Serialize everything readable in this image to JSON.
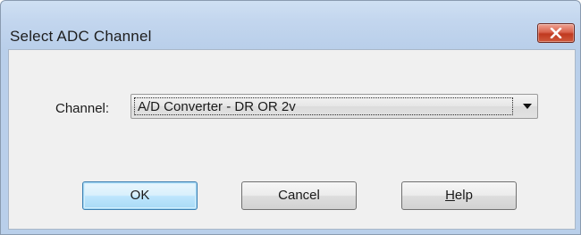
{
  "window": {
    "title": "Select ADC Channel",
    "close_icon": "close-icon"
  },
  "form": {
    "channel_label": "Channel:",
    "channel_value": "A/D Converter - DR OR 2v",
    "dropdown_icon": "chevron-down-icon"
  },
  "buttons": {
    "ok_label": "OK",
    "cancel_label": "Cancel",
    "help_accel": "H",
    "help_rest": "elp"
  },
  "colors": {
    "titlebar": "#c3d6ee",
    "close_button": "#c9452b",
    "default_button_border": "#3c7fb1"
  }
}
